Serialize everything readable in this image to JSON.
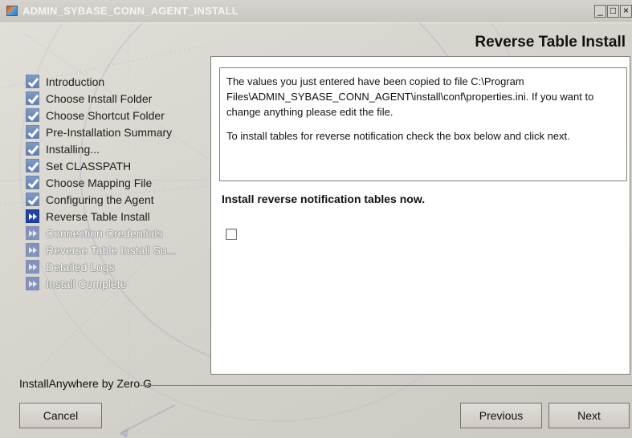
{
  "window": {
    "title": "ADMIN_SYBASE_CONN_AGENT_INSTALL",
    "controls": {
      "minimize": "_",
      "maximize": "□",
      "close": "×"
    }
  },
  "header": {
    "title": "Reverse Table Install"
  },
  "sidebar": {
    "items": [
      {
        "label": "Introduction",
        "status": "complete",
        "icon": "check-icon"
      },
      {
        "label": "Choose Install Folder",
        "status": "complete",
        "icon": "check-icon"
      },
      {
        "label": "Choose Shortcut Folder",
        "status": "complete",
        "icon": "check-icon"
      },
      {
        "label": "Pre-Installation Summary",
        "status": "complete",
        "icon": "check-icon"
      },
      {
        "label": "Installing...",
        "status": "complete",
        "icon": "check-icon"
      },
      {
        "label": "Set CLASSPATH",
        "status": "complete",
        "icon": "check-icon"
      },
      {
        "label": "Choose Mapping File",
        "status": "complete",
        "icon": "check-icon"
      },
      {
        "label": "Configuring the Agent",
        "status": "complete",
        "icon": "check-icon"
      },
      {
        "label": "Reverse Table Install",
        "status": "current",
        "icon": "fast-forward-icon"
      },
      {
        "label": "Connection Credentials",
        "status": "pending",
        "icon": "fast-forward-icon"
      },
      {
        "label": "Reverse Table Install Su...",
        "status": "pending",
        "icon": "fast-forward-icon"
      },
      {
        "label": "Detailed Logs",
        "status": "pending",
        "icon": "fast-forward-icon"
      },
      {
        "label": "Install Complete",
        "status": "pending",
        "icon": "fast-forward-icon"
      }
    ]
  },
  "main": {
    "message_lines": [
      "The values you just entered have been copied to file C:\\Program Files\\ADMIN_SYBASE_CONN_AGENT\\install\\conf\\properties.ini. If you want to change anything please edit the file.",
      "To install tables for reverse notification check the box below and click next."
    ],
    "checkbox_label": "Install reverse notification tables now.",
    "checkbox_checked": false
  },
  "footer": {
    "brand": "InstallAnywhere by Zero G",
    "buttons": {
      "cancel": "Cancel",
      "previous": "Previous",
      "next": "Next"
    }
  },
  "colors": {
    "window_bg": "#d6d3ce",
    "panel_bg": "#ffffff",
    "border": "#7f7f7f",
    "check_icon": "#6f8fc0",
    "current_icon": "#1f43a8",
    "pending_text": "#f7f7f7"
  }
}
